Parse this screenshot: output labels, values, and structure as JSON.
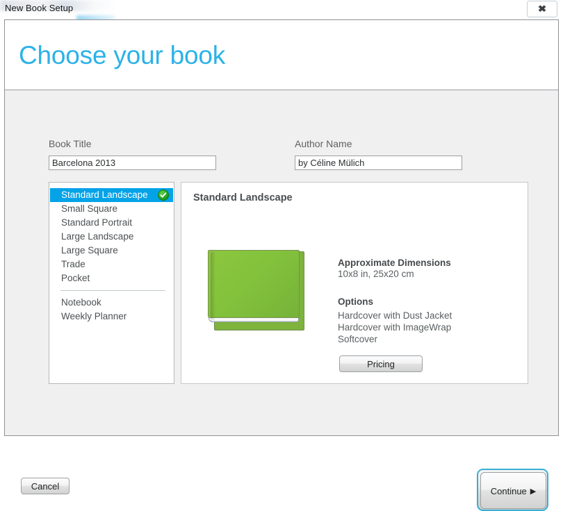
{
  "window": {
    "title": "New Book Setup",
    "close_label": "☒"
  },
  "dialog": {
    "heading": "Choose your book",
    "accent_color": "#2bb2e8"
  },
  "form": {
    "book_title": {
      "label": "Book Title",
      "value": "Barcelona 2013",
      "placeholder": "Book Title"
    },
    "author_name": {
      "label": "Author Name",
      "value": "by Céline Mülich",
      "placeholder": "Author Name"
    }
  },
  "book_types": {
    "selected": "Standard Landscape",
    "selection_color": "#04a3e8",
    "items": [
      {
        "label": "Standard Landscape",
        "selected": true
      },
      {
        "label": "Small Square",
        "selected": false
      },
      {
        "label": "Standard Portrait",
        "selected": false
      },
      {
        "label": "Large Landscape",
        "selected": false
      },
      {
        "label": "Large Square",
        "selected": false
      },
      {
        "label": "Trade",
        "selected": false
      },
      {
        "label": "Pocket",
        "selected": false
      }
    ],
    "items_after_separator": [
      {
        "label": "Notebook",
        "selected": false
      },
      {
        "label": "Weekly Planner",
        "selected": false
      }
    ]
  },
  "detail": {
    "title": "Standard Landscape",
    "book_cover_color": "#8cc63f",
    "dimensions": {
      "heading": "Approximate Dimensions",
      "value": "10x8 in, 25x20 cm"
    },
    "options": {
      "heading": "Options",
      "items": [
        "Hardcover with Dust Jacket",
        "Hardcover with ImageWrap",
        "Softcover"
      ]
    },
    "pricing_button": "Pricing"
  },
  "footer": {
    "cancel": "Cancel",
    "continue": "Continue",
    "continue_arrow": "▶"
  }
}
